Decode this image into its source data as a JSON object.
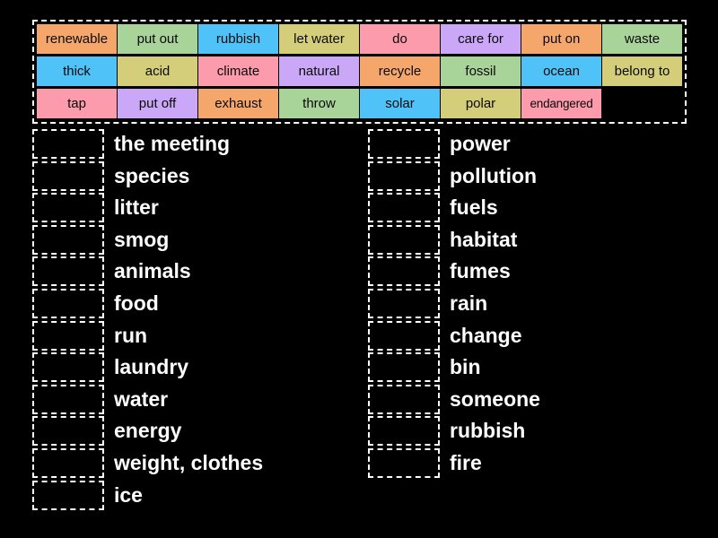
{
  "palette": {
    "background": "#000000",
    "orange": "#F5A76B",
    "green": "#A8D49A",
    "blue": "#4FC3F7",
    "khaki": "#D4CE7A",
    "pink": "#FB9BAC",
    "purple": "#CBA8F7",
    "tile_text": "#0A0A0A",
    "label_text": "#FFFFFF",
    "dashed_border": "#FFFFFF"
  },
  "word_bank": {
    "rows": [
      [
        {
          "label": "renewable",
          "color": "#F5A76B"
        },
        {
          "label": "put out",
          "color": "#A8D49A"
        },
        {
          "label": "rubbish",
          "color": "#4FC3F7"
        },
        {
          "label": "let water",
          "color": "#D4CE7A"
        },
        {
          "label": "do",
          "color": "#FB9BAC"
        },
        {
          "label": "care for",
          "color": "#CBA8F7"
        },
        {
          "label": "put on",
          "color": "#F5A76B"
        },
        {
          "label": "waste",
          "color": "#A8D49A"
        }
      ],
      [
        {
          "label": "thick",
          "color": "#4FC3F7"
        },
        {
          "label": "acid",
          "color": "#D4CE7A"
        },
        {
          "label": "climate",
          "color": "#FB9BAC"
        },
        {
          "label": "natural",
          "color": "#CBA8F7"
        },
        {
          "label": "recycle",
          "color": "#F5A76B"
        },
        {
          "label": "fossil",
          "color": "#A8D49A"
        },
        {
          "label": "ocean",
          "color": "#4FC3F7"
        },
        {
          "label": "belong to",
          "color": "#D4CE7A"
        }
      ],
      [
        {
          "label": "tap",
          "color": "#FB9BAC"
        },
        {
          "label": "put off",
          "color": "#CBA8F7"
        },
        {
          "label": "exhaust",
          "color": "#F5A76B"
        },
        {
          "label": "throw",
          "color": "#A8D49A"
        },
        {
          "label": "solar",
          "color": "#4FC3F7"
        },
        {
          "label": "polar",
          "color": "#D4CE7A"
        },
        {
          "label": "endangered",
          "color": "#FB9BAC"
        },
        {
          "label": "",
          "color": ""
        }
      ]
    ]
  },
  "match_lists": {
    "left": [
      {
        "answer": "",
        "label": "the meeting"
      },
      {
        "answer": "",
        "label": "species"
      },
      {
        "answer": "",
        "label": "litter"
      },
      {
        "answer": "",
        "label": "smog"
      },
      {
        "answer": "",
        "label": "animals"
      },
      {
        "answer": "",
        "label": "food"
      },
      {
        "answer": "",
        "label": "run"
      },
      {
        "answer": "",
        "label": "laundry"
      },
      {
        "answer": "",
        "label": "water"
      },
      {
        "answer": "",
        "label": "energy"
      },
      {
        "answer": "",
        "label": "weight, clothes"
      },
      {
        "answer": "",
        "label": "ice"
      }
    ],
    "right": [
      {
        "answer": "",
        "label": "power"
      },
      {
        "answer": "",
        "label": "pollution"
      },
      {
        "answer": "",
        "label": "fuels"
      },
      {
        "answer": "",
        "label": "habitat"
      },
      {
        "answer": "",
        "label": "fumes"
      },
      {
        "answer": "",
        "label": "rain"
      },
      {
        "answer": "",
        "label": "change"
      },
      {
        "answer": "",
        "label": "bin"
      },
      {
        "answer": "",
        "label": "someone"
      },
      {
        "answer": "",
        "label": "rubbish"
      },
      {
        "answer": "",
        "label": "fire"
      }
    ]
  }
}
